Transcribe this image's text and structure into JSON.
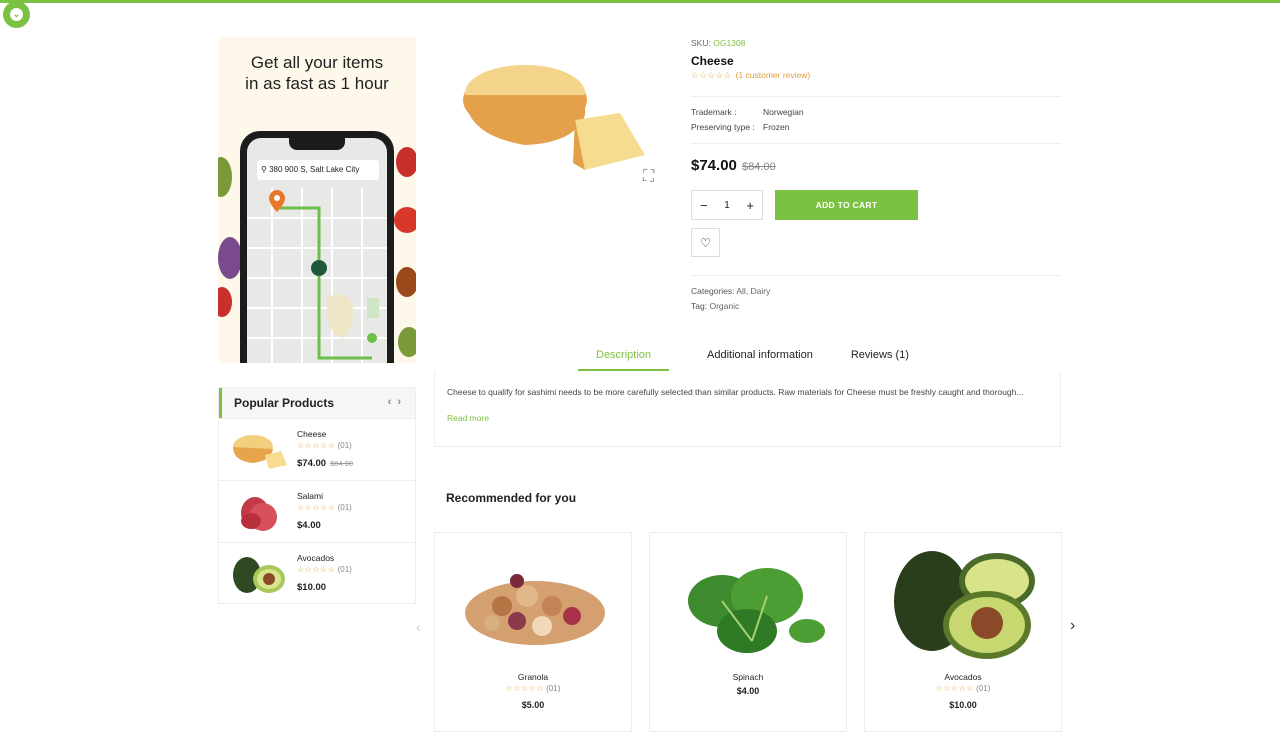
{
  "colors": {
    "accent": "#7bc142",
    "star": "#e0a03a"
  },
  "banner": {
    "line1": "Get all your items",
    "line2": "in as fast as 1 hour",
    "address": "380 900 S, Salt Lake City"
  },
  "product": {
    "sku_label": "SKU:",
    "sku_value": "OG1308",
    "title": "Cheese",
    "rating_stars": "☆☆☆☆☆",
    "review_link": "(1 customer review)",
    "trademark_label": "Trademark :",
    "trademark_value": "Norwegian",
    "preserving_label": "Preserving type :",
    "preserving_value": "Frozen",
    "price": "$74.00",
    "old_price": "$84.00",
    "quantity": "1",
    "minus": "−",
    "plus": "+",
    "add_to_cart": "ADD TO CART",
    "categories_label": "Categories:",
    "categories_value": "All, Dairy",
    "tag_label": "Tag:",
    "tag_value": "Organic"
  },
  "tabs": [
    {
      "label": "Description"
    },
    {
      "label": "Additional information"
    },
    {
      "label": "Reviews (1)"
    }
  ],
  "description": {
    "text": "Cheese to qualify for sashimi needs to be more carefully selected than similar products. Raw materials for Cheese must be freshly caught and thorough...",
    "read_more": "Read more"
  },
  "popular": {
    "title": "Popular Products",
    "items": [
      {
        "name": "Cheese",
        "stars": "☆☆☆☆☆",
        "count": "(01)",
        "price": "$74.00",
        "old_price": "$84.00"
      },
      {
        "name": "Salami",
        "stars": "☆☆☆☆☆",
        "count": "(01)",
        "price": "$4.00",
        "old_price": ""
      },
      {
        "name": "Avocados",
        "stars": "☆☆☆☆☆",
        "count": "(01)",
        "price": "$10.00",
        "old_price": ""
      }
    ]
  },
  "recommended": {
    "title": "Recommended for you",
    "items": [
      {
        "name": "Granola",
        "stars": "☆☆☆☆☆",
        "count": "(01)",
        "price": "$5.00"
      },
      {
        "name": "Spinach",
        "stars": "",
        "count": "",
        "price": "$4.00"
      },
      {
        "name": "Avocados",
        "stars": "☆☆☆☆☆",
        "count": "(01)",
        "price": "$10.00"
      }
    ]
  },
  "icons": [
    "chevron-down-icon",
    "map-pin-icon",
    "zoom-icon",
    "heart-icon",
    "chevron-left-icon",
    "chevron-right-icon"
  ]
}
